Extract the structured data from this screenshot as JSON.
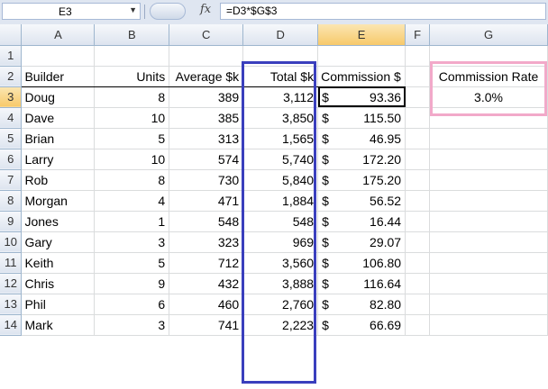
{
  "namebox": "E3",
  "formula": "=D3*$G$3",
  "fx_symbol": "fx",
  "columns": [
    "A",
    "B",
    "C",
    "D",
    "E",
    "F",
    "G"
  ],
  "active_column": "E",
  "rows": [
    "1",
    "2",
    "3",
    "4",
    "5",
    "6",
    "7",
    "8",
    "9",
    "10",
    "11",
    "12",
    "13",
    "14"
  ],
  "active_row": "3",
  "headers": {
    "builder": "Builder",
    "units": "Units",
    "average": "Average $k",
    "total": "Total $k",
    "commission": "Commission $"
  },
  "data_rows": [
    {
      "builder": "Doug",
      "units": "8",
      "average": "389",
      "total": "3,112",
      "commission": "93.36"
    },
    {
      "builder": "Dave",
      "units": "10",
      "average": "385",
      "total": "3,850",
      "commission": "115.50"
    },
    {
      "builder": "Brian",
      "units": "5",
      "average": "313",
      "total": "1,565",
      "commission": "46.95"
    },
    {
      "builder": "Larry",
      "units": "10",
      "average": "574",
      "total": "5,740",
      "commission": "172.20"
    },
    {
      "builder": "Rob",
      "units": "8",
      "average": "730",
      "total": "5,840",
      "commission": "175.20"
    },
    {
      "builder": "Morgan",
      "units": "4",
      "average": "471",
      "total": "1,884",
      "commission": "56.52"
    },
    {
      "builder": "Jones",
      "units": "1",
      "average": "548",
      "total": "548",
      "commission": "16.44"
    },
    {
      "builder": "Gary",
      "units": "3",
      "average": "323",
      "total": "969",
      "commission": "29.07"
    },
    {
      "builder": "Keith",
      "units": "5",
      "average": "712",
      "total": "3,560",
      "commission": "106.80"
    },
    {
      "builder": "Chris",
      "units": "9",
      "average": "432",
      "total": "3,888",
      "commission": "116.64"
    },
    {
      "builder": "Phil",
      "units": "6",
      "average": "460",
      "total": "2,760",
      "commission": "82.80"
    },
    {
      "builder": "Mark",
      "units": "3",
      "average": "741",
      "total": "2,223",
      "commission": "66.69"
    }
  ],
  "currency_symbol": "$",
  "rate_label": "Commission Rate",
  "rate_value": "3.0%",
  "colors": {
    "total_box": "#3a3fbd",
    "rate_box": "#f2a9c9",
    "active_header": "#f7c96a"
  }
}
